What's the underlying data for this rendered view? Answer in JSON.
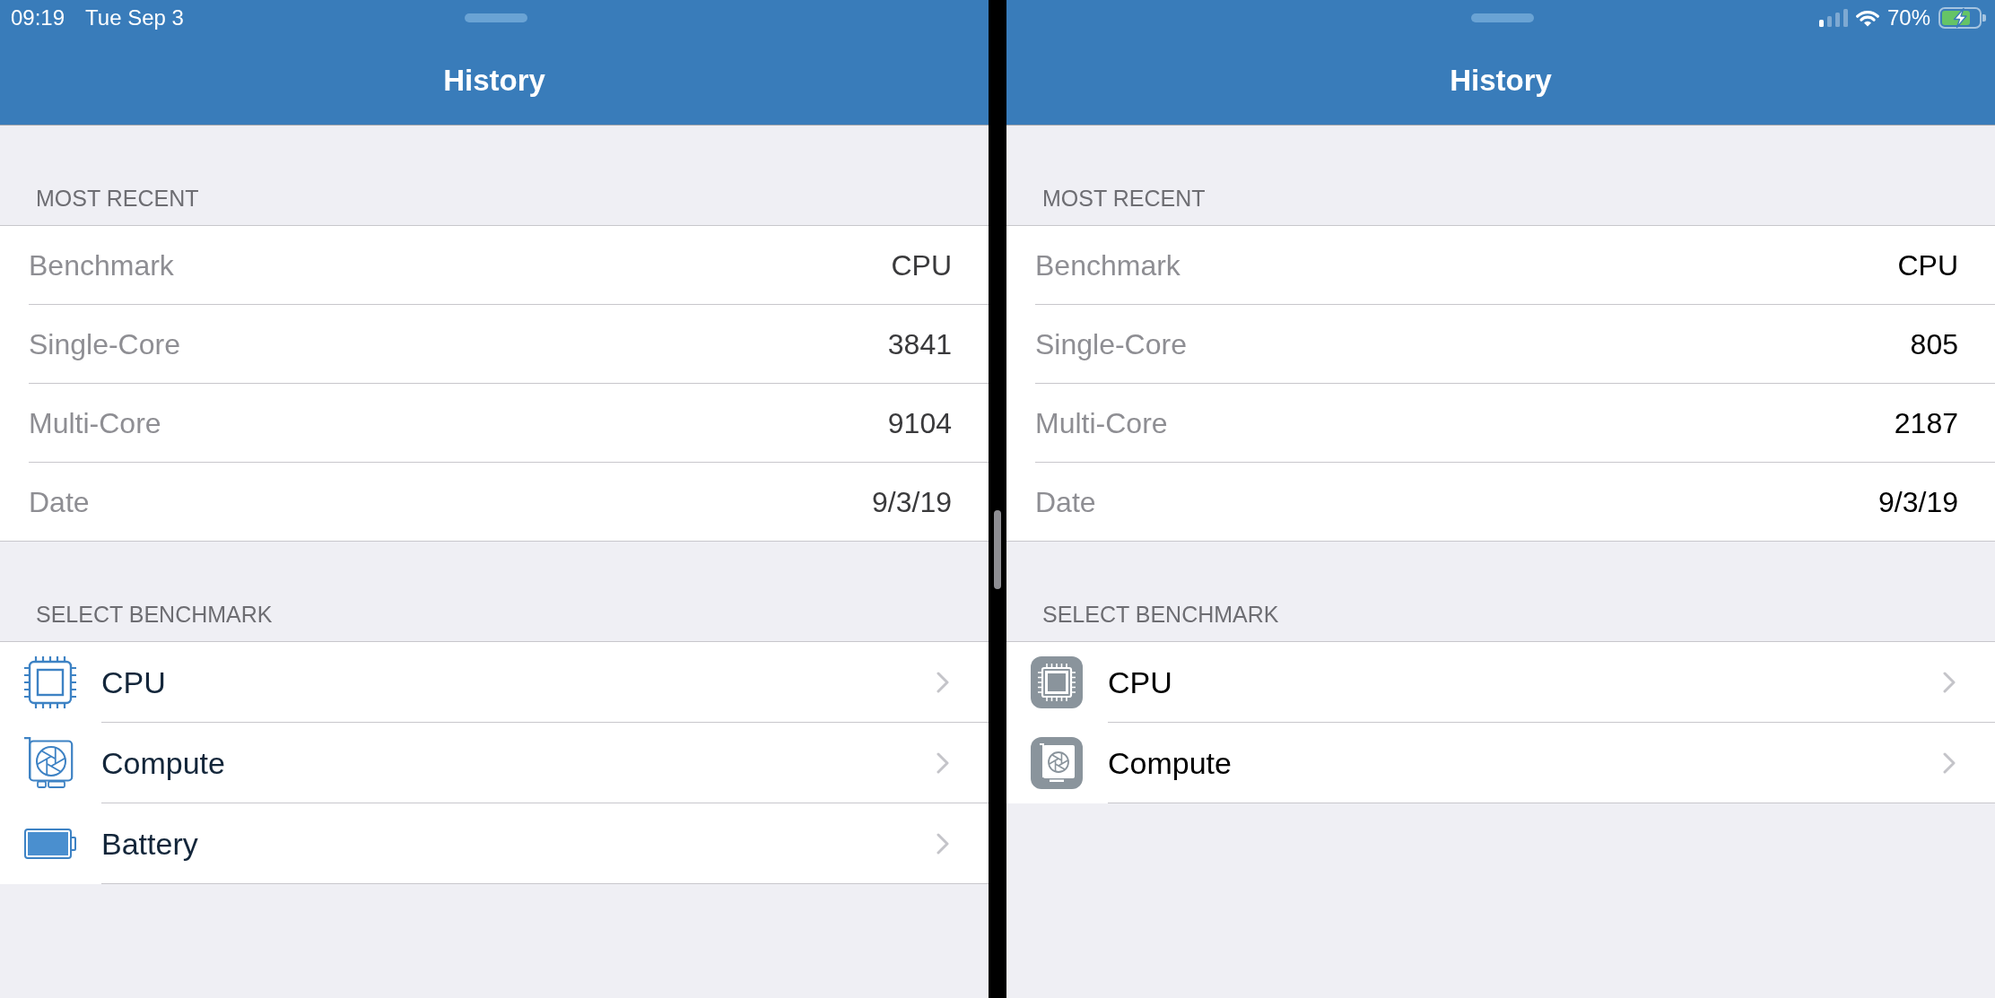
{
  "panes": [
    {
      "status": {
        "time": "09:19",
        "date": "Tue Sep 3"
      },
      "title": "History",
      "tile_icons": false,
      "recent": {
        "header": "MOST RECENT",
        "rows": [
          {
            "label": "Benchmark",
            "value": "CPU"
          },
          {
            "label": "Single-Core",
            "value": "3841"
          },
          {
            "label": "Multi-Core",
            "value": "9104"
          },
          {
            "label": "Date",
            "value": "9/3/19"
          }
        ]
      },
      "select": {
        "header": "SELECT BENCHMARK",
        "items": [
          {
            "kind": "cpu",
            "label": "CPU"
          },
          {
            "kind": "compute",
            "label": "Compute"
          },
          {
            "kind": "battery",
            "label": "Battery"
          }
        ]
      }
    },
    {
      "status": {
        "battery_text": "70%",
        "charging": true
      },
      "title": "History",
      "tile_icons": true,
      "recent": {
        "header": "MOST RECENT",
        "rows": [
          {
            "label": "Benchmark",
            "value": "CPU"
          },
          {
            "label": "Single-Core",
            "value": "805"
          },
          {
            "label": "Multi-Core",
            "value": "2187"
          },
          {
            "label": "Date",
            "value": "9/3/19"
          }
        ]
      },
      "select": {
        "header": "SELECT BENCHMARK",
        "items": [
          {
            "kind": "cpu",
            "label": "CPU"
          },
          {
            "kind": "compute",
            "label": "Compute"
          }
        ]
      }
    }
  ]
}
